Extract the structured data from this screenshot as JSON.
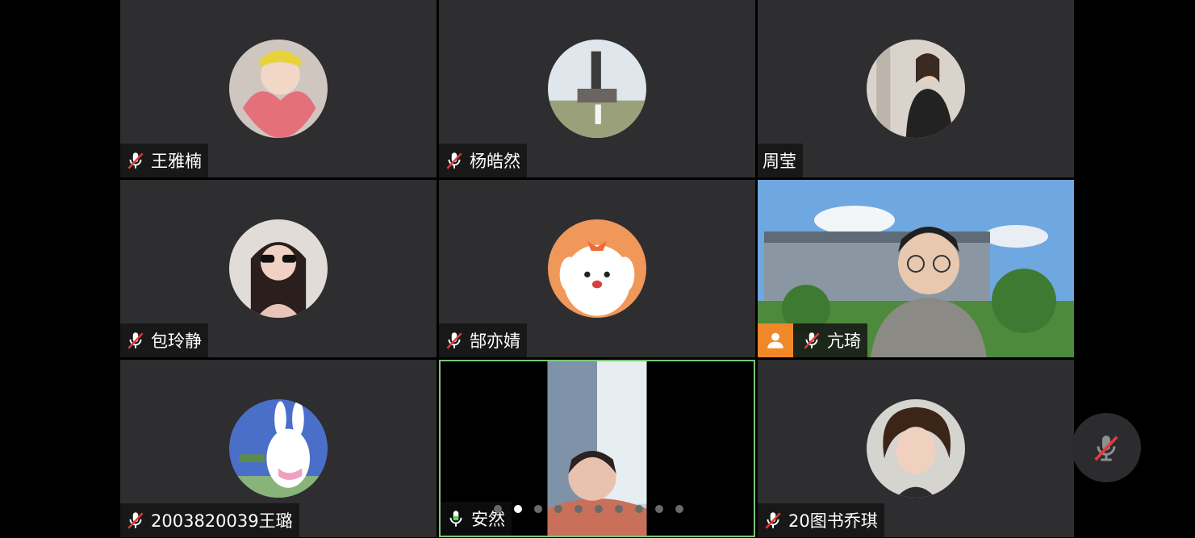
{
  "participants": [
    {
      "name": "王雅楠",
      "mic": "muted"
    },
    {
      "name": "杨皓然",
      "mic": "muted"
    },
    {
      "name": "周莹",
      "mic": "none"
    },
    {
      "name": "包玲静",
      "mic": "muted"
    },
    {
      "name": "郜亦婧",
      "mic": "muted"
    },
    {
      "name": "亢琦",
      "mic": "muted",
      "role": "host"
    },
    {
      "name": "2003820039王璐",
      "mic": "muted"
    },
    {
      "name": "安然",
      "mic": "active",
      "speaking": true
    },
    {
      "name": "20图书乔琪",
      "mic": "muted"
    }
  ],
  "pagination": {
    "total": 10,
    "current": 2
  },
  "controls": {
    "mic_button_icon": "mic-muted-icon"
  },
  "colors": {
    "tile_bg": "#2e2e30",
    "active_border": "#7cc47a",
    "host_badge": "#f0882a",
    "mute_slash": "#e03a3a"
  }
}
